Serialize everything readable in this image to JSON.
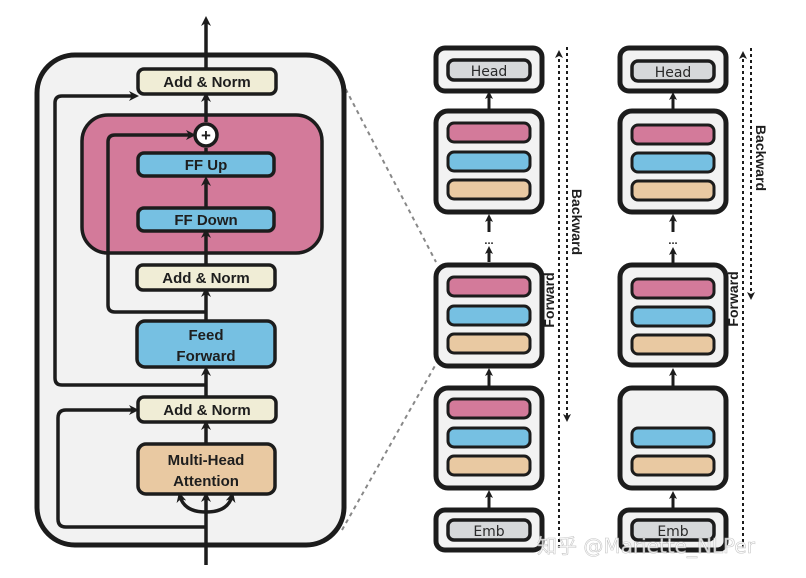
{
  "colors": {
    "outline": "#1c1c1c",
    "panel_bg": "#f2f2f2",
    "add_norm": "#f0edd6",
    "ffn_group": "#d37a9a",
    "ff_block": "#76c0e2",
    "attention": "#e9c9a2",
    "head_emb": "#d6d8da",
    "dashed_line": "#888888"
  },
  "encoder_block": {
    "add_norm_top": "Add & Norm",
    "plus_symbol": "+",
    "ff_up": "FF Up",
    "ff_down": "FF Down",
    "add_norm_middle": "Add & Norm",
    "feed_forward_line1": "Feed",
    "feed_forward_line2": "Forward",
    "add_norm_bottom": "Add & Norm",
    "attention_line1": "Multi-Head",
    "attention_line2": "Attention"
  },
  "stack_left": {
    "head": "Head",
    "emb": "Emb",
    "ellipsis": "...",
    "forward_label": "Forward",
    "backward_label": "Backward",
    "layers": [
      {
        "layers_shown": [
          "pink",
          "blue",
          "tan"
        ]
      },
      {
        "layers_shown": [
          "pink",
          "blue",
          "tan"
        ]
      },
      {
        "layers_shown": [
          "pink",
          "blue",
          "tan"
        ]
      }
    ]
  },
  "stack_right": {
    "head": "Head",
    "emb": "Emb",
    "ellipsis": "...",
    "forward_label": "Forward",
    "backward_label": "Backward",
    "layers": [
      {
        "layers_shown": [
          "pink",
          "blue",
          "tan"
        ]
      },
      {
        "layers_shown": [
          "pink",
          "blue",
          "tan"
        ]
      },
      {
        "layers_shown": [
          "blue",
          "tan"
        ]
      }
    ]
  },
  "watermark": "知乎 @Mariette_NLPer"
}
